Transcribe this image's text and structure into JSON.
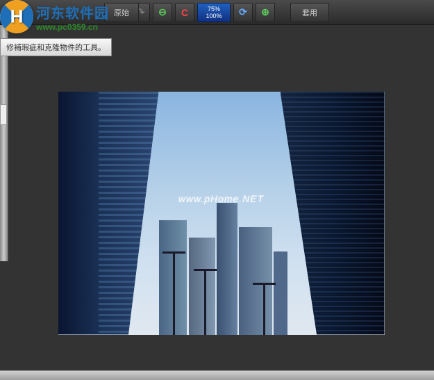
{
  "toolbar": {
    "original_label": "原始",
    "zoom_top": "75%",
    "zoom_bottom": "100%",
    "apply_label": "套用"
  },
  "tooltip": {
    "text": "修補瑕疵和克隆物件的工具。"
  },
  "watermark": {
    "site_name": "河东软件园",
    "site_url": "www.pc0359.cn",
    "logo_letter": "H"
  },
  "image": {
    "watermark_text": "www.pHome.NET"
  }
}
